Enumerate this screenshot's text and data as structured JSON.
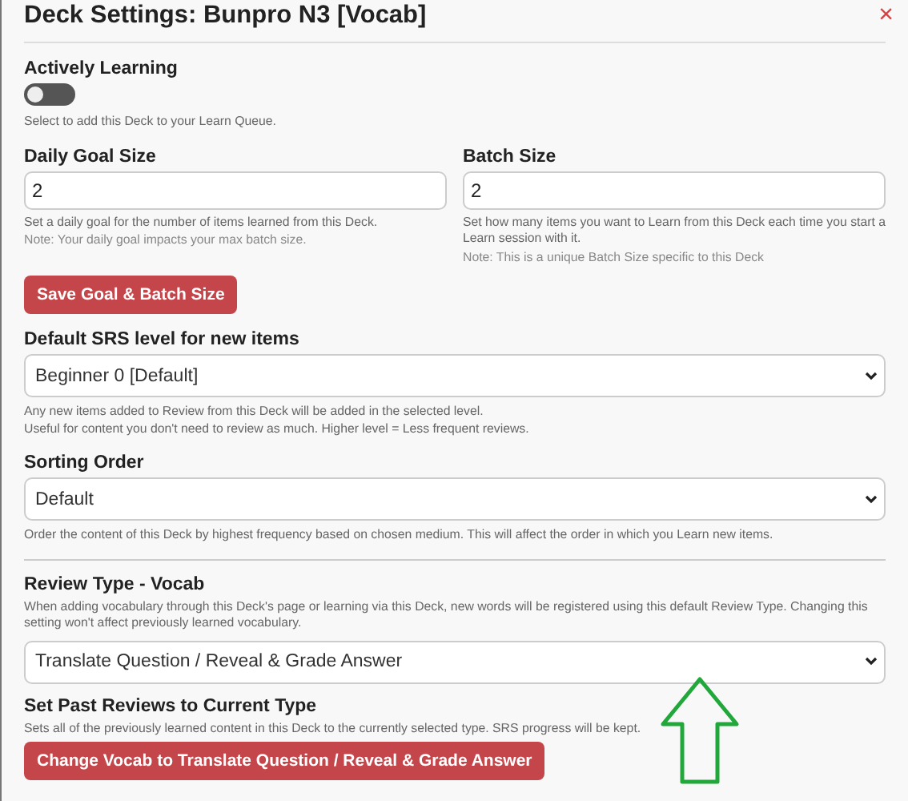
{
  "title": "Deck Settings: Bunpro N3 [Vocab]",
  "close": "×",
  "actively_learning": {
    "label": "Actively Learning",
    "on": false,
    "help": "Select to add this Deck to your Learn Queue."
  },
  "daily_goal": {
    "label": "Daily Goal Size",
    "value": "2",
    "help": [
      "Set a daily goal for the number of items learned from this Deck."
    ],
    "note": "Note: Your daily goal impacts your max batch size."
  },
  "batch_size": {
    "label": "Batch Size",
    "value": "2",
    "help": [
      "Set how many items you want to Learn from this Deck each time you start a Learn session with it."
    ],
    "note": "Note: This is a unique Batch Size specific to this Deck"
  },
  "save_button": "Save Goal & Batch Size",
  "srs_level": {
    "label": "Default SRS level for new items",
    "value": "Beginner 0 [Default]",
    "help": [
      "Any new items added to Review from this Deck will be added in the selected level.",
      "Useful for content you don't need to review as much. Higher level = Less frequent reviews."
    ]
  },
  "sorting_order": {
    "label": "Sorting Order",
    "value": "Default",
    "help": [
      "Order the content of this Deck by highest frequency based on chosen medium. This will affect the order in which you Learn new items."
    ]
  },
  "review_type": {
    "label": "Review Type - Vocab",
    "help": [
      "When adding vocabulary through this Deck's page or learning via this Deck, new words will be registered using this default Review Type. Changing this setting won't affect previously learned vocabulary."
    ],
    "value": "Translate Question / Reveal & Grade Answer"
  },
  "past_reviews": {
    "label": "Set Past Reviews to Current Type",
    "help": [
      "Sets all of the previously learned content in this Deck to the currently selected type. SRS progress will be kept."
    ],
    "button": "Change Vocab to Translate Question / Reveal & Grade Answer"
  }
}
